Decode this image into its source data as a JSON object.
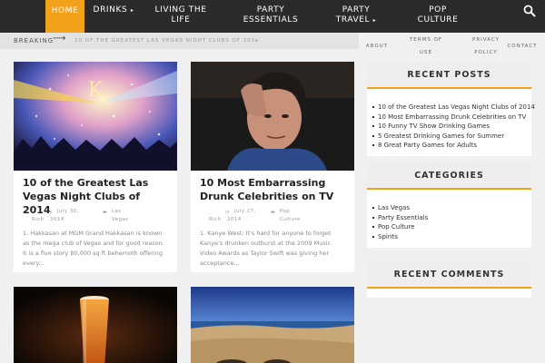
{
  "nav": {
    "items": [
      {
        "label": "HOME"
      },
      {
        "label": "DRINKS",
        "caret": "▸"
      },
      {
        "label_line1": "LIVING THE",
        "label_line2": "LIFE"
      },
      {
        "label_line1": "PARTY",
        "label_line2": "ESSENTIALS"
      },
      {
        "label_line1": "PARTY",
        "label_line2": "TRAVEL",
        "caret": "▸"
      },
      {
        "label_line1": "POP",
        "label_line2": "CULTURE"
      }
    ],
    "search_icon": "search-icon",
    "active_color": "#f2a21a"
  },
  "breaking": {
    "label": "BREAKING",
    "arrow": "⟶",
    "text": "10 OF THE GREATEST LAS VEGAS NIGHT CLUBS OF 201▸"
  },
  "secondary_links": [
    {
      "label": "ABOUT"
    },
    {
      "label_line1": "TERMS OF",
      "label_line2": "USE"
    },
    {
      "label_line1": "PRIVACY",
      "label_line2": "POLICY"
    },
    {
      "label": "CONTACT"
    }
  ],
  "posts": [
    {
      "title": "10 of the Greatest Las Vegas Night Clubs of 2014",
      "date_icon": "clock-icon",
      "date_line1": "July 30,",
      "date_line2": "2014",
      "author": "Rich",
      "cat_icon": "folder-icon",
      "category_line1": "Las",
      "category_line2": "Vegas",
      "excerpt": "1. Hakkasan at MGM Grand Hakkasan is known as the mega club of Vegas and for good reason. It is a five story 80,000 sq ft behemoth offering every..."
    },
    {
      "title": "10 Most Embarrassing Drunk Celebrities on TV",
      "date_icon": "clock-icon",
      "date_line1": "July 27,",
      "date_line2": "2014",
      "author": "Rich",
      "cat_icon": "folder-icon",
      "category_line1": "Pop",
      "category_line2": "Culture",
      "excerpt": "1. Kanye West: It's hard for anyone to forget Kanye's drunken outburst at the 2009 Music Video Awards as Taylor Swift was giving her acceptance..."
    }
  ],
  "widgets": {
    "recent_posts": {
      "title": "RECENT POSTS",
      "items": [
        "10 of the Greatest Las Vegas Night Clubs of 2014",
        "10 Most Embarrassing Drunk Celebrities on TV",
        "10 Funny TV Show Drinking Games",
        "5 Greatest Drinking Games for Summer",
        "8 Great Party Games for Adults"
      ]
    },
    "categories": {
      "title": "CATEGORIES",
      "items": [
        "Las Vegas",
        "Party Essentials",
        "Pop Culture",
        "Spirits"
      ]
    },
    "recent_comments": {
      "title": "RECENT COMMENTS"
    }
  },
  "colors": {
    "accent": "#f2a21a",
    "nav_bg": "#2b2b2b",
    "page_bg": "#f0f0f0"
  }
}
